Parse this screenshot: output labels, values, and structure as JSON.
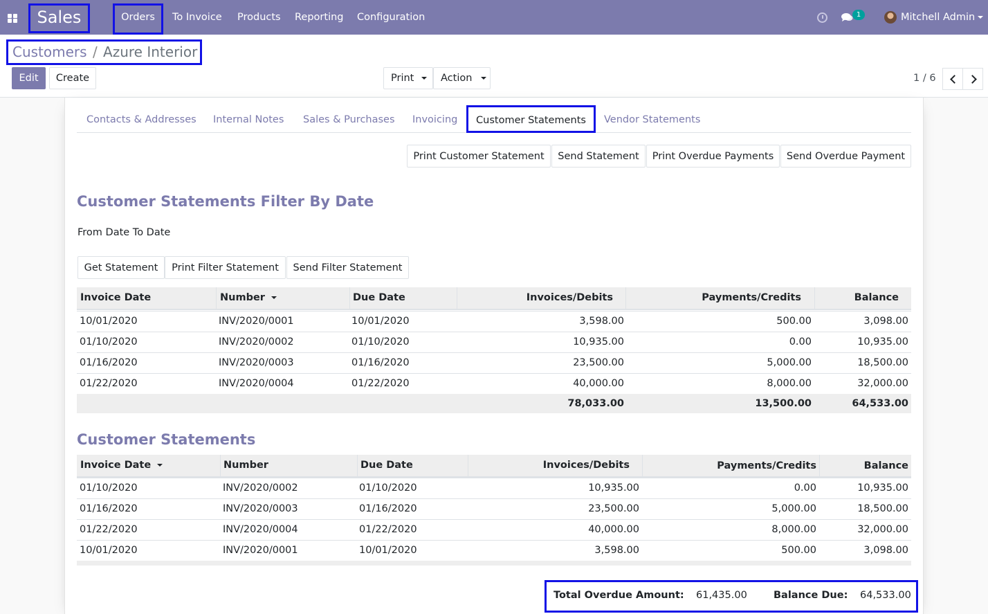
{
  "navbar": {
    "app_name": "Sales",
    "menu": [
      "Orders",
      "To Invoice",
      "Products",
      "Reporting",
      "Configuration"
    ],
    "notification_count": "1",
    "user_name": "Mitchell Admin"
  },
  "breadcrumb": {
    "parent": "Customers",
    "separator": "/",
    "current": "Azure Interior"
  },
  "control": {
    "edit_label": "Edit",
    "create_label": "Create",
    "print_label": "Print",
    "action_label": "Action",
    "pager": "1 / 6"
  },
  "tabs": [
    "Contacts & Addresses",
    "Internal Notes",
    "Sales & Purchases",
    "Invoicing",
    "Customer Statements",
    "Vendor Statements"
  ],
  "statement_buttons": [
    "Print Customer Statement",
    "Send Statement",
    "Print Overdue Payments",
    "Send Overdue Payment"
  ],
  "filter_section": {
    "title": "Customer Statements Filter By Date",
    "date_label": "From Date To Date",
    "buttons": [
      "Get Statement",
      "Print Filter Statement",
      "Send Filter Statement"
    ],
    "columns": [
      "Invoice Date",
      "Number",
      "Due Date",
      "Invoices/Debits",
      "Payments/Credits",
      "Balance"
    ],
    "rows": [
      [
        "10/01/2020",
        "INV/2020/0001",
        "10/01/2020",
        "3,598.00",
        "500.00",
        "3,098.00"
      ],
      [
        "01/10/2020",
        "INV/2020/0002",
        "01/10/2020",
        "10,935.00",
        "0.00",
        "10,935.00"
      ],
      [
        "01/16/2020",
        "INV/2020/0003",
        "01/16/2020",
        "23,500.00",
        "5,000.00",
        "18,500.00"
      ],
      [
        "01/22/2020",
        "INV/2020/0004",
        "01/22/2020",
        "40,000.00",
        "8,000.00",
        "32,000.00"
      ]
    ],
    "totals": [
      "78,033.00",
      "13,500.00",
      "64,533.00"
    ]
  },
  "statements_section": {
    "title": "Customer Statements",
    "columns": [
      "Invoice Date",
      "Number",
      "Due Date",
      "Invoices/Debits",
      "Payments/Credits",
      "Balance"
    ],
    "rows": [
      [
        "01/10/2020",
        "INV/2020/0002",
        "01/10/2020",
        "10,935.00",
        "0.00",
        "10,935.00"
      ],
      [
        "01/16/2020",
        "INV/2020/0003",
        "01/16/2020",
        "23,500.00",
        "5,000.00",
        "18,500.00"
      ],
      [
        "01/22/2020",
        "INV/2020/0004",
        "01/22/2020",
        "40,000.00",
        "8,000.00",
        "32,000.00"
      ],
      [
        "10/01/2020",
        "INV/2020/0001",
        "10/01/2020",
        "3,598.00",
        "500.00",
        "3,098.00"
      ]
    ]
  },
  "summary": {
    "overdue_label": "Total Overdue Amount:",
    "overdue_value": "61,435.00",
    "balance_label": "Balance Due:",
    "balance_value": "64,533.00"
  }
}
